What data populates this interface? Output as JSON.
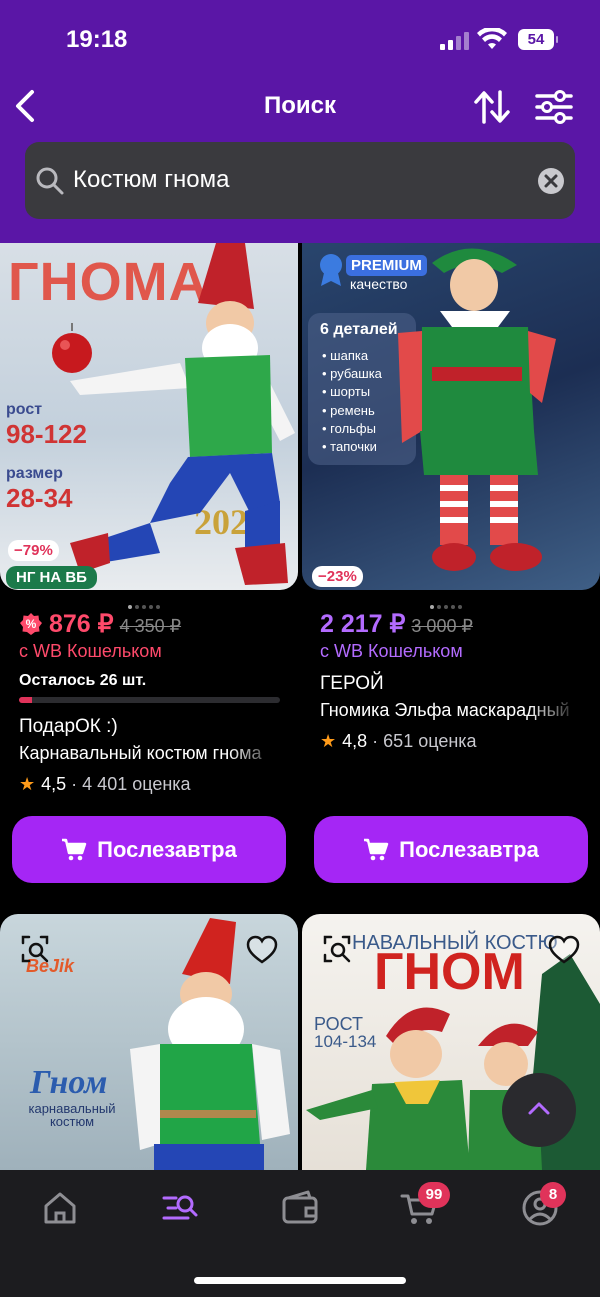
{
  "status": {
    "time": "19:18",
    "battery": "54"
  },
  "header": {
    "title": "Поиск"
  },
  "search": {
    "query": "Костюм гнома"
  },
  "products": [
    {
      "promo": {
        "title": "ГНОМА",
        "height_label": "рост",
        "height": "98-122",
        "size_label": "размер",
        "size": "28-34",
        "year": "2025"
      },
      "discount": "−79%",
      "badge": "НГ НА ВБ",
      "price": "876 ₽",
      "old_price": "4 350 ₽",
      "wallet_note": "с WB Кошельком",
      "stock_text": "Осталось 26 шт.",
      "stock_level": 0.05,
      "brand": "ПодарОК :)",
      "name": "Карнавальный костюм гнома",
      "rating": "4,5",
      "reviews": "4 401 оценка",
      "button": "Послезавтра",
      "price_color": "#ff4a6b"
    },
    {
      "promo": {
        "badge": "PREMIUM",
        "badge_sub": "качество",
        "list_title": "6 деталей",
        "items": [
          "шапка",
          "рубашка",
          "шорты",
          "ремень",
          "гольфы",
          "тапочки"
        ]
      },
      "discount": "−23%",
      "price": "2 217 ₽",
      "old_price": "3 000 ₽",
      "wallet_note": "с WB Кошельком",
      "brand": "ГЕРОЙ",
      "name": "Гномика Эльфа маскарадный",
      "rating": "4,8",
      "reviews": "651 оценка",
      "button": "Послезавтра",
      "price_color": "#b36bff"
    },
    {
      "promo": {
        "logo": "BeJik",
        "title": "Гном",
        "subtitle": "карнавальный костюм"
      }
    },
    {
      "promo": {
        "banner": "НАВАЛЬНЫЙ КОСТЮ",
        "title": "ГНОМ",
        "height_label": "РОСТ",
        "height": "104-134"
      }
    }
  ],
  "tabbar": {
    "cart_count": "99",
    "profile_count": "8"
  },
  "colors": {
    "header": "#5a16a6",
    "accent": "#a526f5",
    "sale": "#e0335a"
  }
}
